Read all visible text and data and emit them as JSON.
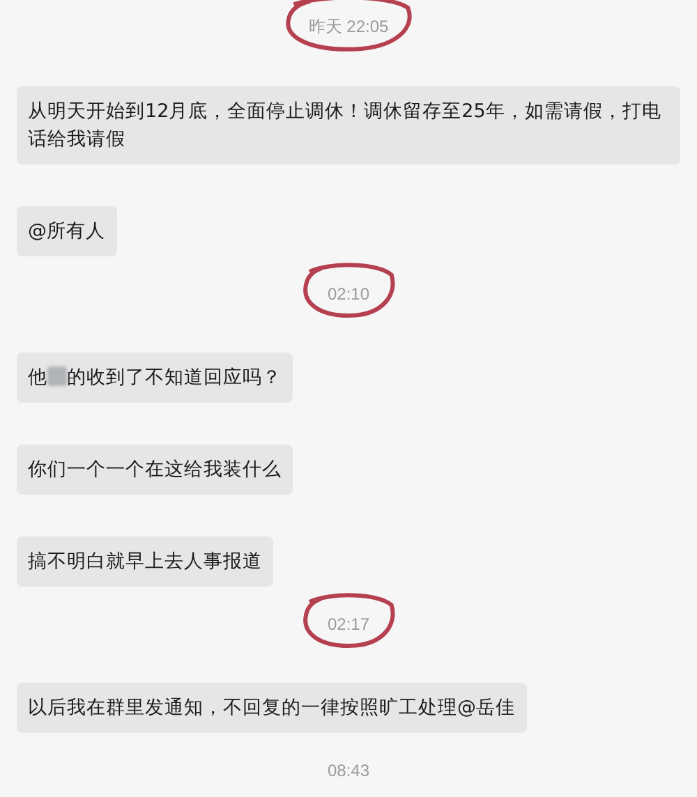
{
  "messages": [
    {
      "kind": "time",
      "text": "昨天 22:05",
      "circled": true
    },
    {
      "kind": "text",
      "text": "从明天开始到12月底，全面停止调休！调休留存至25年，如需请假，打电话给我请假"
    },
    {
      "kind": "text",
      "text": "@所有人"
    },
    {
      "kind": "time",
      "text": "02:10",
      "circled": true
    },
    {
      "kind": "redacted",
      "before": "他",
      "after": "的收到了不知道回应吗？"
    },
    {
      "kind": "text",
      "text": "你们一个一个在这给我装什么"
    },
    {
      "kind": "text",
      "text": "搞不明白就早上去人事报道"
    },
    {
      "kind": "time",
      "text": "02:17",
      "circled": true
    },
    {
      "kind": "text",
      "text": "以后我在群里发通知，不回复的一律按照旷工处理@岳佳"
    },
    {
      "kind": "time",
      "text": "08:43",
      "circled": false
    }
  ]
}
